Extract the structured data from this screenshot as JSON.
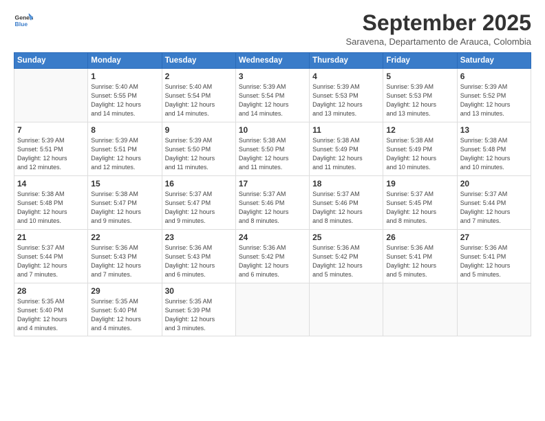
{
  "header": {
    "logo": {
      "general": "General",
      "blue": "Blue"
    },
    "title": "September 2025",
    "subtitle": "Saravena, Departamento de Arauca, Colombia"
  },
  "days_of_week": [
    "Sunday",
    "Monday",
    "Tuesday",
    "Wednesday",
    "Thursday",
    "Friday",
    "Saturday"
  ],
  "weeks": [
    [
      {
        "day": "",
        "info": ""
      },
      {
        "day": "1",
        "info": "Sunrise: 5:40 AM\nSunset: 5:55 PM\nDaylight: 12 hours\nand 14 minutes."
      },
      {
        "day": "2",
        "info": "Sunrise: 5:40 AM\nSunset: 5:54 PM\nDaylight: 12 hours\nand 14 minutes."
      },
      {
        "day": "3",
        "info": "Sunrise: 5:39 AM\nSunset: 5:54 PM\nDaylight: 12 hours\nand 14 minutes."
      },
      {
        "day": "4",
        "info": "Sunrise: 5:39 AM\nSunset: 5:53 PM\nDaylight: 12 hours\nand 13 minutes."
      },
      {
        "day": "5",
        "info": "Sunrise: 5:39 AM\nSunset: 5:53 PM\nDaylight: 12 hours\nand 13 minutes."
      },
      {
        "day": "6",
        "info": "Sunrise: 5:39 AM\nSunset: 5:52 PM\nDaylight: 12 hours\nand 13 minutes."
      }
    ],
    [
      {
        "day": "7",
        "info": "Sunrise: 5:39 AM\nSunset: 5:51 PM\nDaylight: 12 hours\nand 12 minutes."
      },
      {
        "day": "8",
        "info": "Sunrise: 5:39 AM\nSunset: 5:51 PM\nDaylight: 12 hours\nand 12 minutes."
      },
      {
        "day": "9",
        "info": "Sunrise: 5:39 AM\nSunset: 5:50 PM\nDaylight: 12 hours\nand 11 minutes."
      },
      {
        "day": "10",
        "info": "Sunrise: 5:38 AM\nSunset: 5:50 PM\nDaylight: 12 hours\nand 11 minutes."
      },
      {
        "day": "11",
        "info": "Sunrise: 5:38 AM\nSunset: 5:49 PM\nDaylight: 12 hours\nand 11 minutes."
      },
      {
        "day": "12",
        "info": "Sunrise: 5:38 AM\nSunset: 5:49 PM\nDaylight: 12 hours\nand 10 minutes."
      },
      {
        "day": "13",
        "info": "Sunrise: 5:38 AM\nSunset: 5:48 PM\nDaylight: 12 hours\nand 10 minutes."
      }
    ],
    [
      {
        "day": "14",
        "info": "Sunrise: 5:38 AM\nSunset: 5:48 PM\nDaylight: 12 hours\nand 10 minutes."
      },
      {
        "day": "15",
        "info": "Sunrise: 5:38 AM\nSunset: 5:47 PM\nDaylight: 12 hours\nand 9 minutes."
      },
      {
        "day": "16",
        "info": "Sunrise: 5:37 AM\nSunset: 5:47 PM\nDaylight: 12 hours\nand 9 minutes."
      },
      {
        "day": "17",
        "info": "Sunrise: 5:37 AM\nSunset: 5:46 PM\nDaylight: 12 hours\nand 8 minutes."
      },
      {
        "day": "18",
        "info": "Sunrise: 5:37 AM\nSunset: 5:46 PM\nDaylight: 12 hours\nand 8 minutes."
      },
      {
        "day": "19",
        "info": "Sunrise: 5:37 AM\nSunset: 5:45 PM\nDaylight: 12 hours\nand 8 minutes."
      },
      {
        "day": "20",
        "info": "Sunrise: 5:37 AM\nSunset: 5:44 PM\nDaylight: 12 hours\nand 7 minutes."
      }
    ],
    [
      {
        "day": "21",
        "info": "Sunrise: 5:37 AM\nSunset: 5:44 PM\nDaylight: 12 hours\nand 7 minutes."
      },
      {
        "day": "22",
        "info": "Sunrise: 5:36 AM\nSunset: 5:43 PM\nDaylight: 12 hours\nand 7 minutes."
      },
      {
        "day": "23",
        "info": "Sunrise: 5:36 AM\nSunset: 5:43 PM\nDaylight: 12 hours\nand 6 minutes."
      },
      {
        "day": "24",
        "info": "Sunrise: 5:36 AM\nSunset: 5:42 PM\nDaylight: 12 hours\nand 6 minutes."
      },
      {
        "day": "25",
        "info": "Sunrise: 5:36 AM\nSunset: 5:42 PM\nDaylight: 12 hours\nand 5 minutes."
      },
      {
        "day": "26",
        "info": "Sunrise: 5:36 AM\nSunset: 5:41 PM\nDaylight: 12 hours\nand 5 minutes."
      },
      {
        "day": "27",
        "info": "Sunrise: 5:36 AM\nSunset: 5:41 PM\nDaylight: 12 hours\nand 5 minutes."
      }
    ],
    [
      {
        "day": "28",
        "info": "Sunrise: 5:35 AM\nSunset: 5:40 PM\nDaylight: 12 hours\nand 4 minutes."
      },
      {
        "day": "29",
        "info": "Sunrise: 5:35 AM\nSunset: 5:40 PM\nDaylight: 12 hours\nand 4 minutes."
      },
      {
        "day": "30",
        "info": "Sunrise: 5:35 AM\nSunset: 5:39 PM\nDaylight: 12 hours\nand 3 minutes."
      },
      {
        "day": "",
        "info": ""
      },
      {
        "day": "",
        "info": ""
      },
      {
        "day": "",
        "info": ""
      },
      {
        "day": "",
        "info": ""
      }
    ]
  ]
}
